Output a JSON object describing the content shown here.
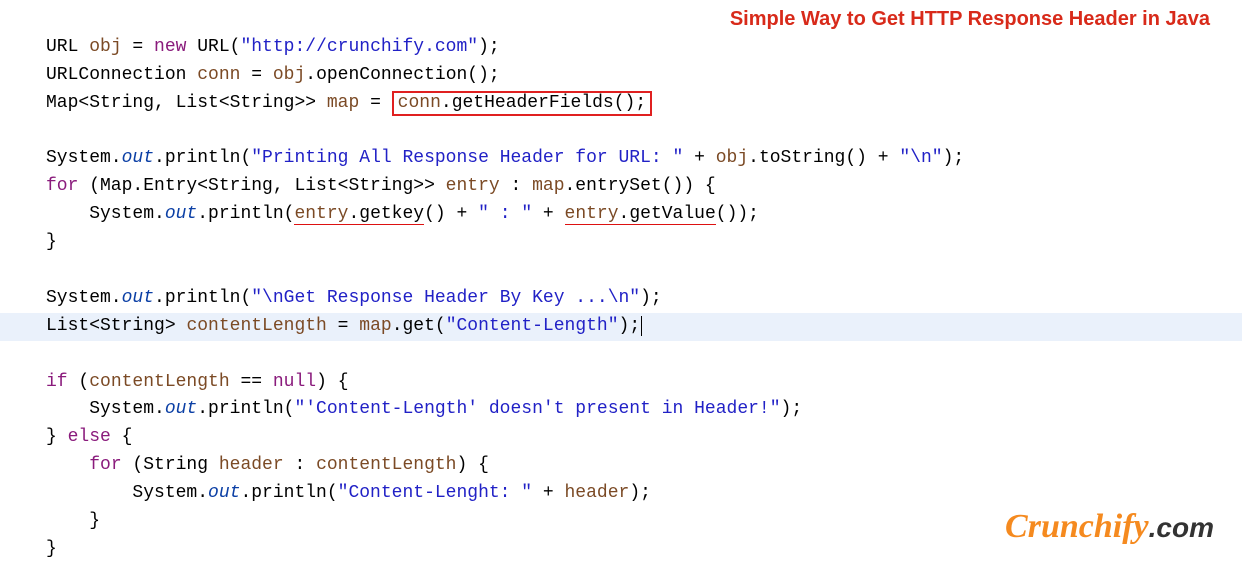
{
  "title": "Simple Way to Get HTTP Response Header in Java",
  "brand": {
    "left": "Crunchify",
    "right": ".com"
  },
  "code": {
    "l1": {
      "t1": "URL ",
      "v": "obj",
      "t2": " = ",
      "kw": "new",
      "t3": " URL(",
      "s": "\"http://crunchify.com\"",
      "t4": ");"
    },
    "l2": {
      "t1": "URLConnection ",
      "v": "conn",
      "t2": " = ",
      "v2": "obj",
      "t3": ".openConnection();"
    },
    "l3": {
      "t1": "Map<String, List<String>> ",
      "v": "map",
      "t2": " = ",
      "boxed": "conn.getHeaderFields();"
    },
    "l3b": {
      "v": "conn"
    },
    "l5a": "System.",
    "l5out": "out",
    "l5b": ".println(",
    "l5s": "\"Printing All Response Header for URL: \"",
    "l5c": " + ",
    "l5v": "obj",
    "l5d": ".toString() + ",
    "l5s2": "\"\\n\"",
    "l5e": ");",
    "l6a": "for",
    "l6b": " (Map.Entry<String, List<String>> ",
    "l6v": "entry",
    "l6c": " : ",
    "l6v2": "map",
    "l6d": ".entrySet()) {",
    "l7a": "    System.",
    "l7out": "out",
    "l7b": ".println(",
    "l7u1": "entry.getkey",
    "l7c": "() + ",
    "l7s": "\" : \"",
    "l7d": " + ",
    "l7u2": "entry.getValue",
    "l7e": "());",
    "l8": "}",
    "l10a": "System.",
    "l10out": "out",
    "l10b": ".println(",
    "l10s": "\"\\nGet Response Header By Key ...\\n\"",
    "l10c": ");",
    "l11a": "List<String> ",
    "l11v": "contentLength",
    "l11b": " = ",
    "l11v2": "map",
    "l11c": ".get(",
    "l11s": "\"Content-Length\"",
    "l11d": ");",
    "l12a": "if",
    "l12b": " (",
    "l12v": "contentLength",
    "l12c": " == ",
    "l12kw": "null",
    "l12d": ") {",
    "l13a": "    System.",
    "l13out": "out",
    "l13b": ".println(",
    "l13s": "\"'Content-Length' doesn't present in Header!\"",
    "l13c": ");",
    "l14a": "} ",
    "l14kw": "else",
    "l14b": " {",
    "l15a": "    ",
    "l15kw": "for",
    "l15b": " (String ",
    "l15v": "header",
    "l15c": " : ",
    "l15v2": "contentLength",
    "l15d": ") {",
    "l16a": "        System.",
    "l16out": "out",
    "l16b": ".println(",
    "l16s": "\"Content-Lenght: \"",
    "l16c": " + ",
    "l16v": "header",
    "l16d": ");",
    "l17": "    }",
    "l18": "}"
  }
}
